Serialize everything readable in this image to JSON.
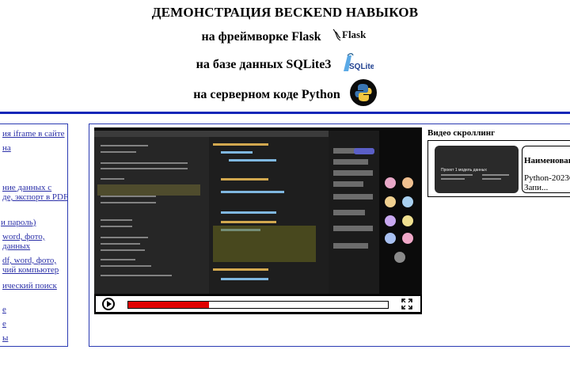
{
  "header": {
    "title": "ДЕМОНСТРАЦИЯ BECKEND НАВЫКОВ",
    "line_framework": "на фреймворке Flask",
    "line_db": "на базе данных SQLite3",
    "line_code": "на серверном коде Python",
    "flask_logo_text": "Flask",
    "sqlite_logo_text": "SQLite"
  },
  "sidebar": {
    "items": [
      {
        "label": "ия iframe в сайте"
      },
      {
        "label": "на"
      },
      {
        "label": "ние данных с\nде, экспорт в PDF"
      },
      {
        "label": "и пароль)"
      },
      {
        "label": "word, фото,\nданных"
      },
      {
        "label": "df, word, фото,\nчий компьютер"
      },
      {
        "label": "ический поиск"
      },
      {
        "label": "е"
      },
      {
        "label": "е"
      },
      {
        "label": "ы"
      }
    ]
  },
  "player": {
    "progress": 0.31,
    "accent": "#e00000",
    "play_icon": "play-icon",
    "fullscreen_icon": "fullscreen-icon"
  },
  "scroller": {
    "title": "Видео скроллинг",
    "card1_text": "Проект 1 модель данных",
    "card2_title": "Наименован",
    "card2_text": "Python-2023С\nЗапи..."
  },
  "colors": {
    "rule": "#1226b8",
    "border": "#2b3bb3",
    "link": "#2a2fa8"
  }
}
